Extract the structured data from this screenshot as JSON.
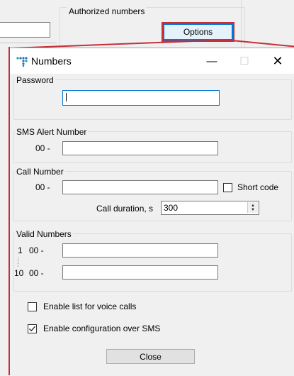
{
  "parent": {
    "authorized_label": "Authorized numbers",
    "options_label": "Options"
  },
  "dialog": {
    "title": "Numbers",
    "minimize_glyph": "—",
    "maximize_glyph": "☐",
    "close_glyph": "✕",
    "password": {
      "legend": "Password",
      "value": ""
    },
    "sms_alert": {
      "legend": "SMS Alert Number",
      "prefix": "00 -",
      "value": ""
    },
    "call_number": {
      "legend": "Call Number",
      "prefix": "00 -",
      "value": "",
      "short_code_label": "Short code",
      "short_code_checked": false,
      "duration_label": "Call duration, s",
      "duration_value": "300"
    },
    "valid_numbers": {
      "legend": "Valid Numbers",
      "rows": [
        {
          "index": "1",
          "prefix": "00 -",
          "value": ""
        },
        {
          "index": "10",
          "prefix": "00 -",
          "value": ""
        }
      ]
    },
    "enable_voice": {
      "label": "Enable list for voice calls",
      "checked": false
    },
    "enable_sms_config": {
      "label": "Enable configuration over SMS",
      "checked": true
    },
    "close_label": "Close"
  },
  "colors": {
    "accent": "#0078d7",
    "highlight": "#c4303a",
    "icon_blue": "#2f6cc0",
    "icon_teal": "#16a3a3"
  }
}
